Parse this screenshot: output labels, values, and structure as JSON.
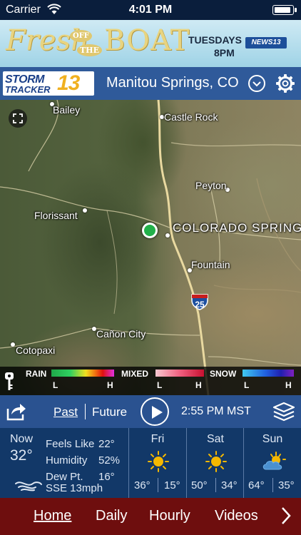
{
  "status_bar": {
    "carrier": "Carrier",
    "time": "4:01 PM"
  },
  "ad": {
    "title_1": "Fresh",
    "title_2": "OFF",
    "title_3": "THE",
    "title_4": "BOAT",
    "airs": "TUESDAYS",
    "air_time": "8PM",
    "channel_logo": "NEWS13"
  },
  "header": {
    "brand_line1": "STORM",
    "brand_line2": "TRACKER",
    "brand_number": "13",
    "location": "Manitou Springs, CO"
  },
  "map": {
    "cities": {
      "bailey": "Bailey",
      "castle_rock": "Castle Rock",
      "peyton": "Peyton",
      "florissant": "Florissant",
      "colorado_springs": "COLORADO SPRINGS",
      "fountain": "Fountain",
      "canon_city": "Cañon City",
      "cotopaxi": "Cotopaxi"
    },
    "interstate": "25"
  },
  "legend": {
    "rain": "RAIN",
    "mixed": "MIXED",
    "snow": "SNOW",
    "low": "L",
    "high": "H"
  },
  "controls": {
    "past": "Past",
    "future": "Future",
    "timestamp": "2:55 PM MST"
  },
  "current": {
    "now_label": "Now",
    "temp": "32°",
    "feels_like_label": "Feels Like",
    "feels_like": "22°",
    "humidity_label": "Humidity",
    "humidity": "52%",
    "dew_point_label": "Dew Pt.",
    "dew_point": "16°",
    "wind": "SSE 13mph"
  },
  "forecast": [
    {
      "day": "Fri",
      "icon": "sun-icon",
      "high": "36°",
      "low": "15°"
    },
    {
      "day": "Sat",
      "icon": "sun-icon",
      "high": "50°",
      "low": "34°"
    },
    {
      "day": "Sun",
      "icon": "partly-cloudy-icon",
      "high": "64°",
      "low": "35°"
    }
  ],
  "nav": {
    "home": "Home",
    "daily": "Daily",
    "hourly": "Hourly",
    "videos": "Videos"
  },
  "colors": {
    "header_blue": "#2f5a9a",
    "controls_blue": "#2a5290",
    "conditions_navy": "#123868",
    "nav_maroon": "#6e0e0e",
    "location_marker": "#22b04a",
    "sun_yellow": "#f5b800"
  }
}
